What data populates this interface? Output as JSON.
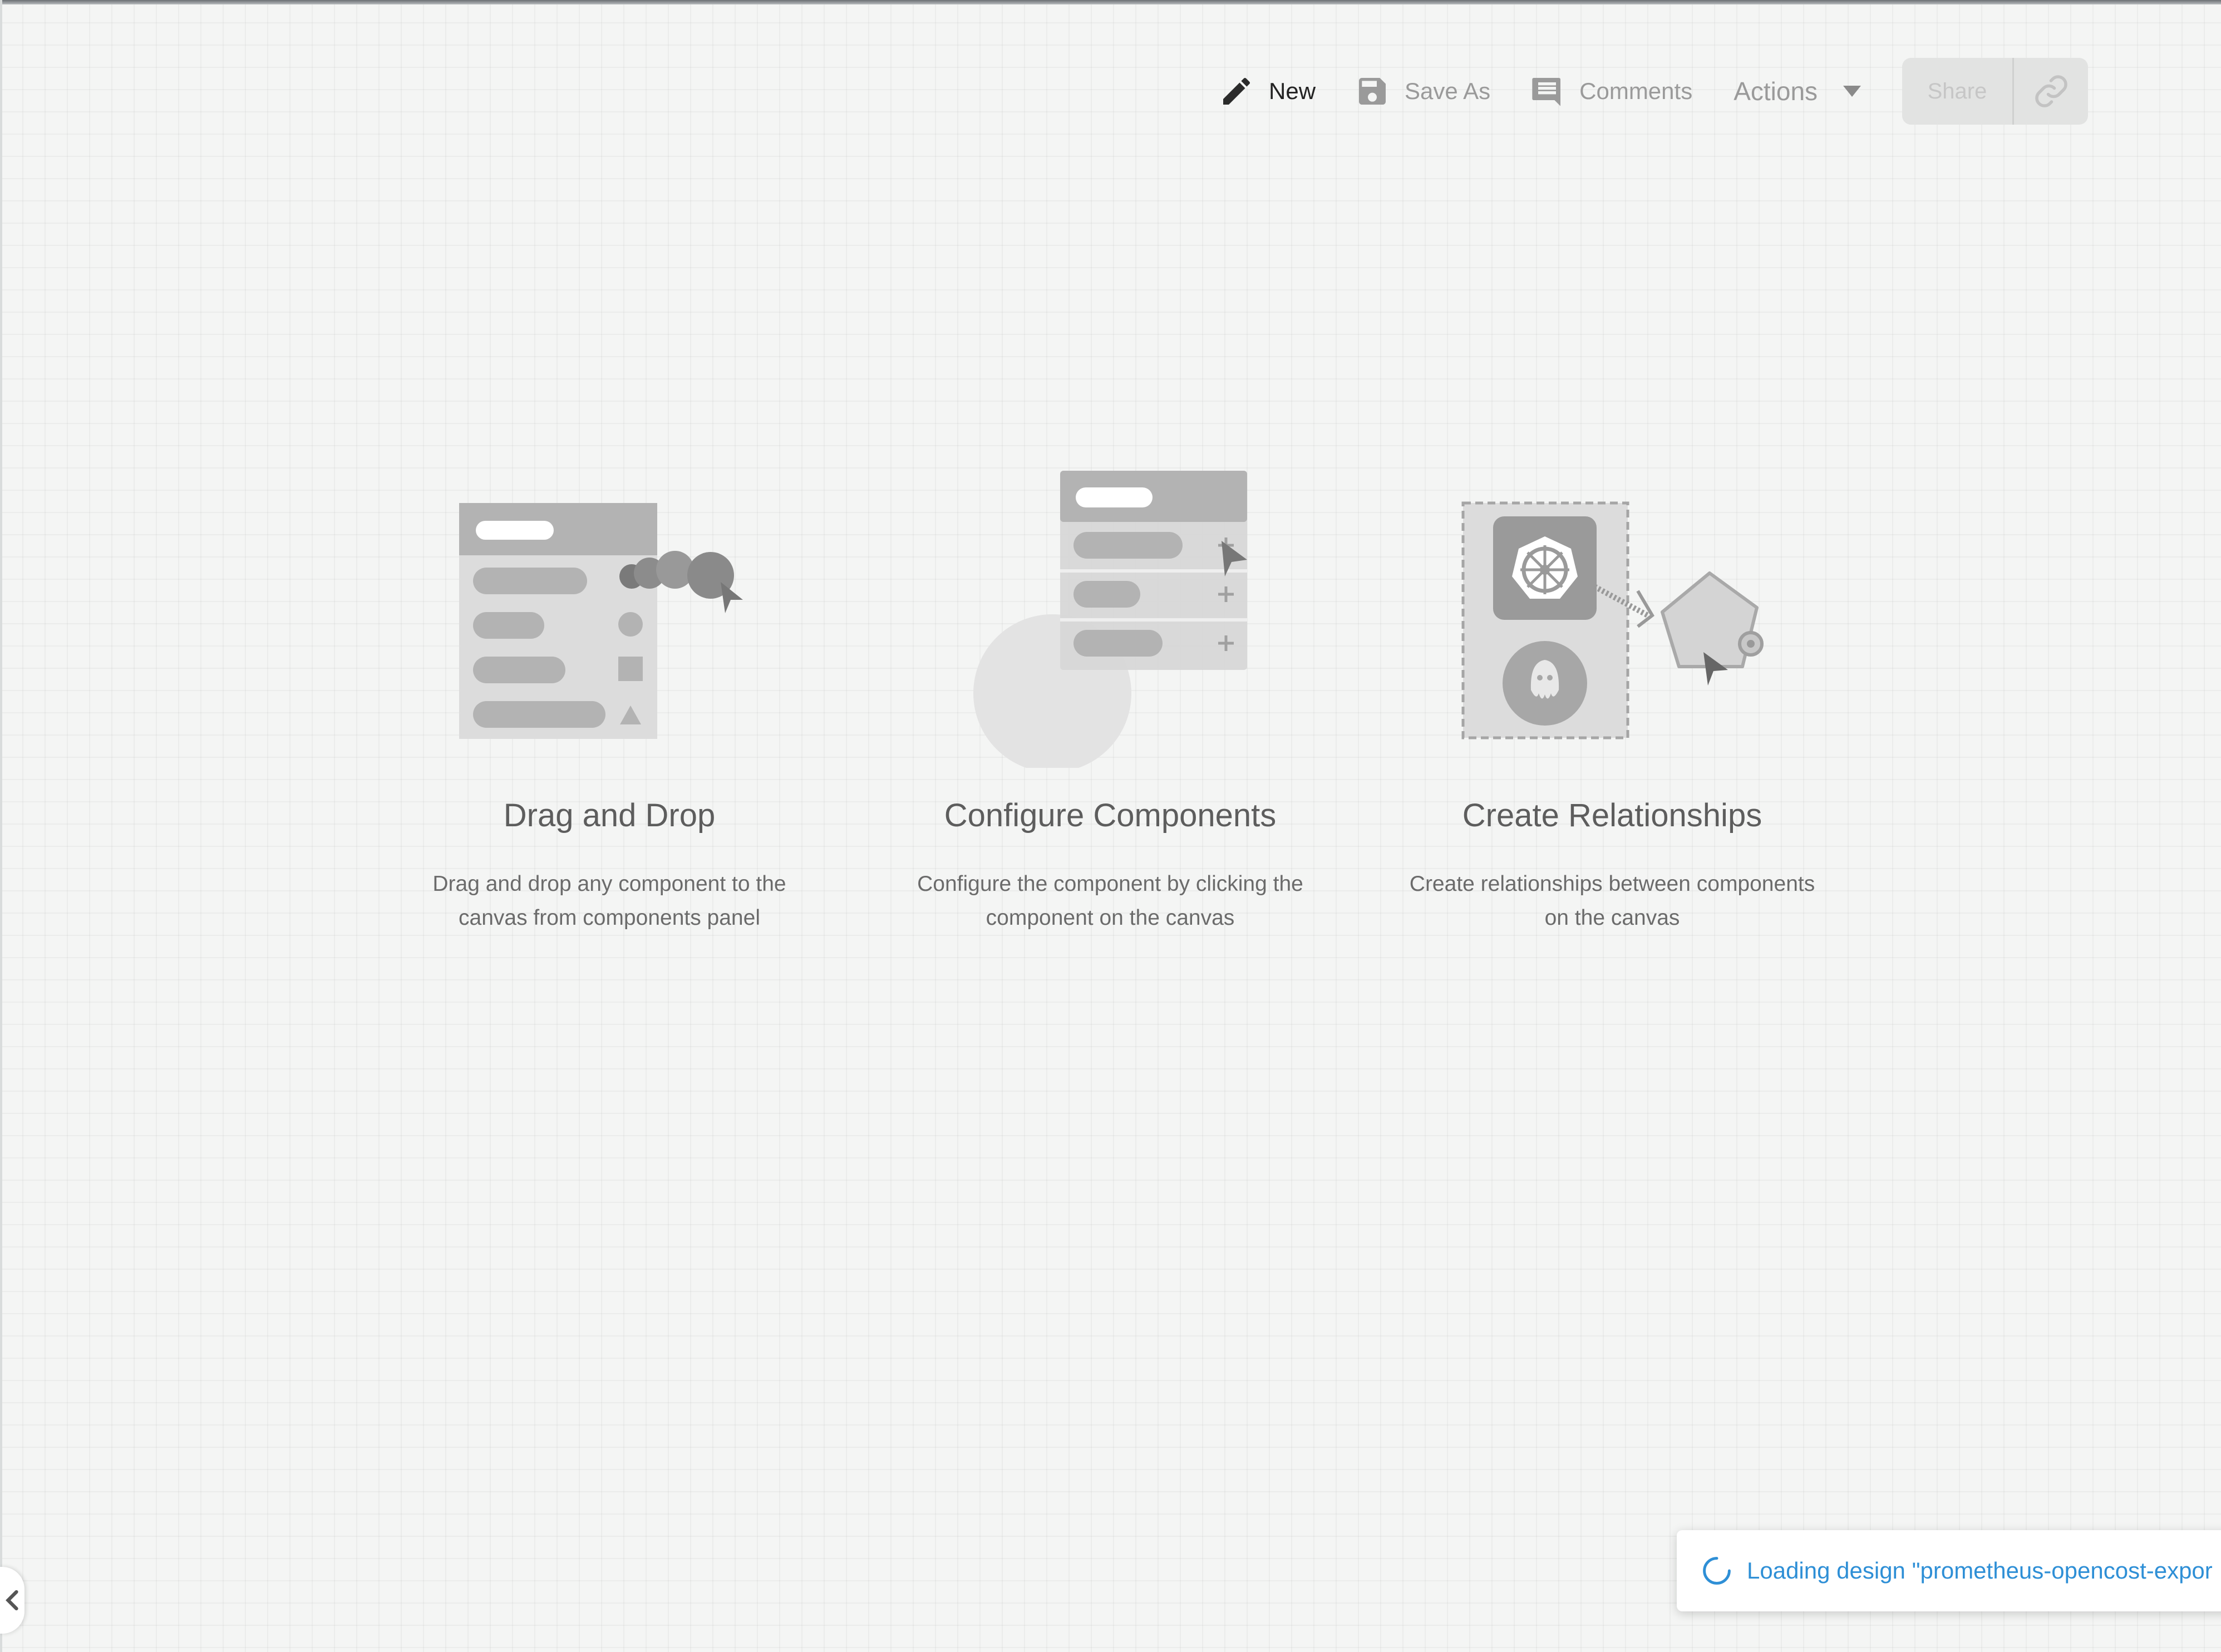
{
  "toolbar": {
    "new_label": "New",
    "save_as_label": "Save As",
    "comments_label": "Comments",
    "actions_label": "Actions",
    "share_label": "Share"
  },
  "cards": [
    {
      "title": "Drag and Drop",
      "desc_line1": "Drag and drop any component to the",
      "desc_line2": "canvas from components panel"
    },
    {
      "title": "Configure Components",
      "desc_line1": "Configure the component by clicking the",
      "desc_line2": "component on the canvas"
    },
    {
      "title": "Create Relationships",
      "desc_line1": "Create relationships between components",
      "desc_line2": "on the canvas"
    }
  ],
  "toast": {
    "message": "Loading design \"prometheus-opencost-expor"
  },
  "colors": {
    "accent": "#2e8fd6",
    "background": "#f4f5f4",
    "disabled": "#9a9a9a"
  },
  "icons": [
    "pencil-icon",
    "save-icon",
    "comment-icon",
    "chevron-down-icon",
    "link-icon",
    "spinner-icon",
    "chevron-left-icon",
    "kubernetes-icon",
    "octopus-icon"
  ]
}
